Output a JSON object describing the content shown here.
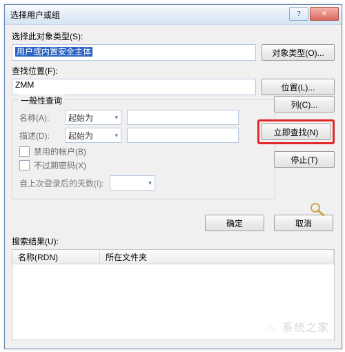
{
  "titlebar": {
    "title": "选择用户或组"
  },
  "object_type": {
    "label": "选择此对象类型(S):",
    "value": "用户或内置安全主体",
    "button": "对象类型(O)..."
  },
  "location": {
    "label": "查找位置(F):",
    "value": "ZMM",
    "button": "位置(L)..."
  },
  "common": {
    "legend": "一般性查询",
    "name_label": "名称(A):",
    "name_combo": "起始为",
    "desc_label": "描述(D):",
    "desc_combo": "起始为",
    "disabled_accounts": "禁用的帐户(B)",
    "nonexpiring_pw": "不过期密码(X)",
    "days_since_logon": "自上次登录后的天数(I):"
  },
  "side": {
    "columns": "列(C)...",
    "find_now": "立即查找(N)",
    "stop": "停止(T)"
  },
  "footer": {
    "ok": "确定",
    "cancel": "取消"
  },
  "results": {
    "label": "搜索结果(U):",
    "columns": [
      "名称(RDN)",
      "所在文件夹"
    ]
  },
  "watermark": {
    "text": "系统之家"
  }
}
